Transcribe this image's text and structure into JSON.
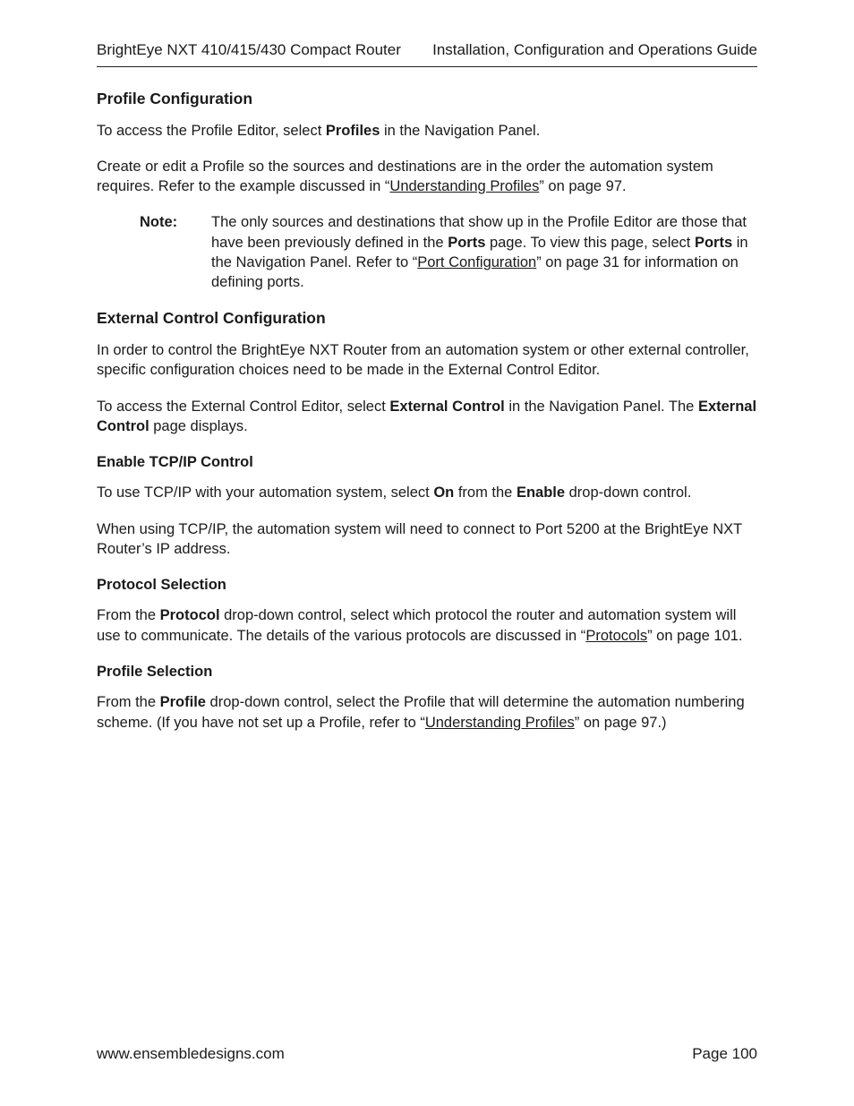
{
  "header": {
    "left": "BrightEye NXT 410/415/430 Compact Router",
    "right": "Installation, Configuration and Operations Guide"
  },
  "section_profile": {
    "title": "Profile Configuration",
    "p1_a": "To access the Profile Editor, select ",
    "p1_bold": "Profiles",
    "p1_b": " in the Navigation Panel.",
    "p2_a": "Create or edit a Profile so the sources and destinations are in the order the automation system requires. Refer to the example discussed in “",
    "p2_link": "Understanding Profiles",
    "p2_b": "” on page 97.",
    "note": {
      "label": "Note:",
      "t1": "The only sources and destinations that show up in the Profile Editor are those that have been previously defined in the ",
      "b1": "Ports",
      "t2": " page. To view this page, select ",
      "b2": "Ports",
      "t3": " in the Navigation Panel. Refer to “",
      "link": "Port Configuration",
      "t4": "” on page 31 for information on defining ports."
    }
  },
  "section_external": {
    "title": "External Control Configuration",
    "p1": "In order to control the BrightEye NXT Router from an automation system or other external controller, specific configuration choices need to be made in the External Control Editor.",
    "p2_a": "To access the External Control Editor, select ",
    "p2_b1": "External Control",
    "p2_b": " in the Navigation Panel. The ",
    "p2_b2": "External Control",
    "p2_c": " page displays.",
    "tcp": {
      "title": "Enable TCP/IP Control",
      "p1_a": "To use TCP/IP with your automation system, select ",
      "p1_b1": "On",
      "p1_b": " from the ",
      "p1_b2": "Enable",
      "p1_c": " drop-down control.",
      "p2": "When using TCP/IP, the automation system will need to connect to Port 5200 at the BrightEye NXT Router’s IP address."
    },
    "protocol": {
      "title": "Protocol Selection",
      "p1_a": "From the ",
      "p1_b": "Protocol",
      "p1_c": " drop-down control, select which protocol the router and automation system will use to communicate. The details of the various protocols are discussed in “",
      "p1_link": "Protocols",
      "p1_d": "” on page 101."
    },
    "profile_sel": {
      "title": "Profile Selection",
      "p1_a": "From the ",
      "p1_b": "Profile",
      "p1_c": " drop-down control, select the Profile that will determine the automation numbering scheme. (If you have not set up a Profile, refer to “",
      "p1_link": "Understanding Profiles",
      "p1_d": "” on page 97.)"
    }
  },
  "footer": {
    "left": "www.ensembledesigns.com",
    "right": "Page 100"
  }
}
